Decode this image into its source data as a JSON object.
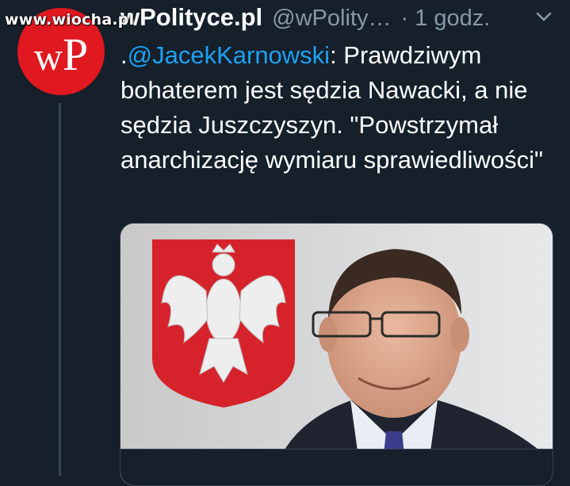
{
  "watermark": "www.wiocha.pl",
  "avatar": {
    "logo_w": "w",
    "logo_p": "P"
  },
  "header": {
    "display_name": "wPolityce.pl",
    "handle": "@wPolity…",
    "separator": "·",
    "time": "1 godz."
  },
  "tweet": {
    "prefix": ".",
    "mention": "@JacekKarnowski",
    "body": ": Prawdziwym bohaterem jest sędzia Nawacki, a nie sędzia Juszczyszyn. \"Powstrzymał anarchizację wymiaru sprawiedliwości\""
  },
  "icons": {
    "menu": "chevron-down-icon",
    "avatar": "wp-logo"
  },
  "colors": {
    "background": "#15202b",
    "text": "#ffffff",
    "secondary": "#8899a6",
    "link": "#1da1f2",
    "avatar": "#e0181f",
    "flag_red": "#d6232b"
  }
}
